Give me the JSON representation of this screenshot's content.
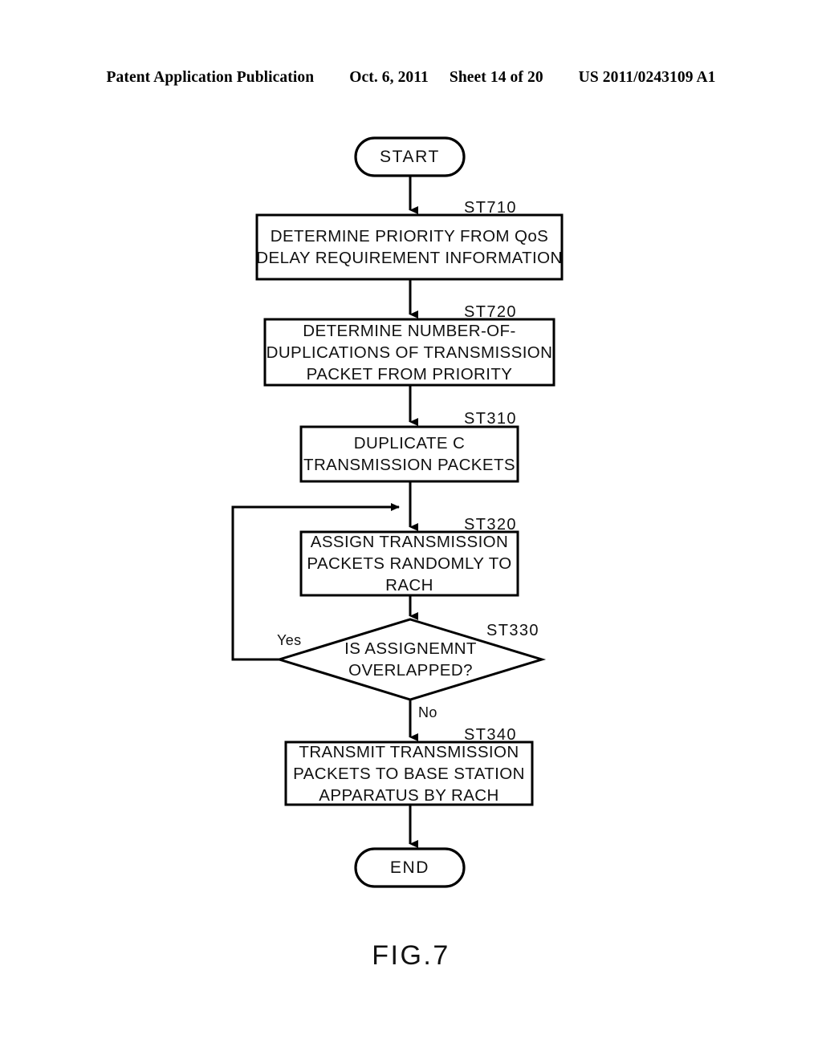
{
  "page": {
    "figure_caption": "FIG.7",
    "background_color": "#ffffff",
    "ink_color": "#000000"
  },
  "header": {
    "publication_title": "Patent Application Publication",
    "date": "Oct. 6, 2011",
    "sheet": "Sheet 14 of 20",
    "publication_number": "US 2011/0243109 A1"
  },
  "flowchart": {
    "title": "FIG.7",
    "nodes": [
      {
        "id": "start",
        "type": "terminator",
        "lines": [
          "START"
        ],
        "step_label": ""
      },
      {
        "id": "st710",
        "type": "process",
        "lines": [
          "DETERMINE PRIORITY FROM QoS",
          "DELAY REQUIREMENT INFORMATION"
        ],
        "step_label": "ST710"
      },
      {
        "id": "st720",
        "type": "process",
        "lines": [
          "DETERMINE NUMBER-OF-",
          "DUPLICATIONS OF TRANSMISSION",
          "PACKET FROM PRIORITY"
        ],
        "step_label": "ST720"
      },
      {
        "id": "st310",
        "type": "process",
        "lines": [
          "DUPLICATE C",
          "TRANSMISSION PACKETS"
        ],
        "step_label": "ST310"
      },
      {
        "id": "st320",
        "type": "process",
        "lines": [
          "ASSIGN TRANSMISSION",
          "PACKETS RANDOMLY TO",
          "RACH"
        ],
        "step_label": "ST320"
      },
      {
        "id": "st330",
        "type": "decision",
        "lines": [
          "IS ASSIGNEMNT",
          "OVERLAPPED?"
        ],
        "step_label": "ST330"
      },
      {
        "id": "st340",
        "type": "process",
        "lines": [
          "TRANSMIT TRANSMISSION",
          "PACKETS TO BASE STATION",
          "APPARATUS BY RACH"
        ],
        "step_label": "ST340"
      },
      {
        "id": "end",
        "type": "terminator",
        "lines": [
          "END"
        ],
        "step_label": ""
      }
    ],
    "branches": {
      "yes_label": "Yes",
      "no_label": "No"
    }
  }
}
